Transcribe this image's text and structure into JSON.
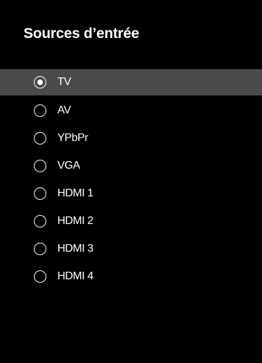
{
  "menu": {
    "title": "Sources d’entrée",
    "selected_index": 0,
    "items": [
      {
        "label": "TV"
      },
      {
        "label": "AV"
      },
      {
        "label": "YPbPr"
      },
      {
        "label": "VGA"
      },
      {
        "label": "HDMI 1"
      },
      {
        "label": "HDMI 2"
      },
      {
        "label": "HDMI 3"
      },
      {
        "label": "HDMI 4"
      }
    ]
  },
  "colors": {
    "background": "#000000",
    "text": "#ffffff",
    "selected_row": "#4a4a4a"
  },
  "icons": {
    "selected": "radio-selected-icon",
    "unselected": "radio-unselected-icon"
  }
}
